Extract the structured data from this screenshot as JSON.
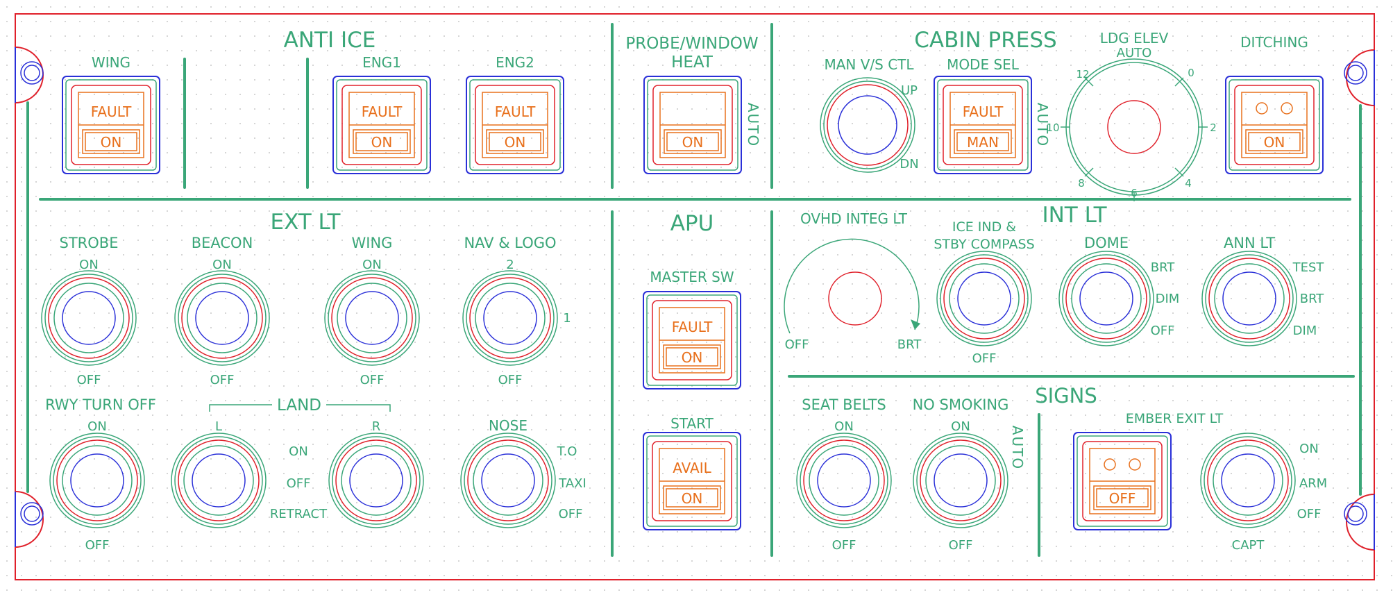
{
  "colors": {
    "panel_outline": "#e0202a",
    "label_green": "#3aa678",
    "ring_red": "#e0202a",
    "knob_blue": "#2a30d8",
    "light_orange": "#e8701c",
    "dot_grid": "#c8c8c8"
  },
  "sections": {
    "anti_ice": "ANTI ICE",
    "probe_window_line1": "PROBE/WINDOW",
    "probe_window_line2": "HEAT",
    "cabin_press": "CABIN PRESS",
    "ext_lt": "EXT LT",
    "apu": "APU",
    "int_lt": "INT LT",
    "signs": "SIGNS"
  },
  "anti_ice": {
    "wing": {
      "label": "WING",
      "upper": "FAULT",
      "lower": "ON"
    },
    "eng1": {
      "label": "ENG1",
      "upper": "FAULT",
      "lower": "ON"
    },
    "eng2": {
      "label": "ENG2",
      "upper": "FAULT",
      "lower": "ON"
    }
  },
  "probe_heat": {
    "upper": "",
    "lower": "ON",
    "side_label": "AUTO"
  },
  "cabin_press": {
    "man_vs_ctl": {
      "label": "MAN V/S CTL",
      "up": "UP",
      "dn": "DN"
    },
    "mode_sel": {
      "label": "MODE SEL",
      "upper": "FAULT",
      "lower": "MAN",
      "side_label": "AUTO"
    },
    "ldg_elev": {
      "label_line1": "LDG ELEV",
      "label_line2": "AUTO",
      "ticks": {
        "t12": "12",
        "t0": "0",
        "t10": "10",
        "t2": "2",
        "t8": "8",
        "t6": "6",
        "t4": "4"
      }
    },
    "ditching": {
      "label": "DITCHING",
      "lower": "ON"
    }
  },
  "ext_lt": {
    "strobe": {
      "label": "STROBE",
      "top": "ON",
      "bottom": "OFF"
    },
    "beacon": {
      "label": "BEACON",
      "top": "ON",
      "bottom": "OFF"
    },
    "wing": {
      "label": "WING",
      "top": "ON",
      "bottom": "OFF"
    },
    "nav_logo": {
      "label": "NAV & LOGO",
      "top": "2",
      "right": "1",
      "bottom": "OFF"
    },
    "rwy_turn_off": {
      "label": "RWY TURN OFF",
      "top": "ON",
      "bottom": "OFF"
    },
    "land": {
      "label": "LAND",
      "left": "L",
      "right": "R",
      "on": "ON",
      "off": "OFF",
      "retract": "RETRACT"
    },
    "nose": {
      "label": "NOSE",
      "to": "T.O",
      "taxi": "TAXI",
      "off": "OFF"
    }
  },
  "apu": {
    "master_sw": {
      "label": "MASTER SW",
      "upper": "FAULT",
      "lower": "ON"
    },
    "start": {
      "label": "START",
      "upper": "AVAIL",
      "lower": "ON"
    }
  },
  "int_lt": {
    "ovhd_integ_lt": {
      "label": "OVHD INTEG LT",
      "off": "OFF",
      "brt": "BRT"
    },
    "ice_ind": {
      "label_line1": "ICE IND &",
      "label_line2": "STBY COMPASS",
      "bottom": "OFF"
    },
    "dome": {
      "label": "DOME",
      "brt": "BRT",
      "dim": "DIM",
      "off": "OFF"
    },
    "ann_lt": {
      "label": "ANN LT",
      "test": "TEST",
      "brt": "BRT",
      "dim": "DIM"
    }
  },
  "signs": {
    "seat_belts": {
      "label": "SEAT BELTS",
      "top": "ON",
      "bottom": "OFF"
    },
    "no_smoking": {
      "label": "NO SMOKING",
      "top": "ON",
      "bottom": "OFF",
      "side_label": "AUTO"
    },
    "emer_exit_lt": {
      "label": "EMBER EXIT LT",
      "lower": "OFF",
      "on": "ON",
      "arm": "ARM",
      "off": "OFF",
      "bottom": "CAPT"
    }
  }
}
